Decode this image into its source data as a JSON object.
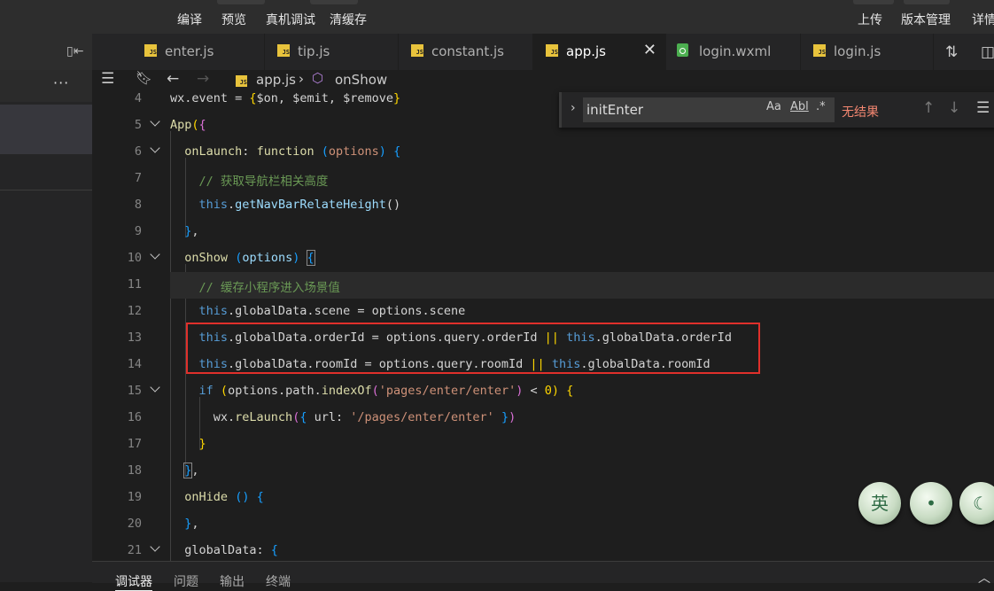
{
  "menu": [
    "编译",
    "预览",
    "真机调试",
    "清缓存",
    "上传",
    "版本管理",
    "详情"
  ],
  "tabs": [
    {
      "label": "enter.js",
      "icon": "js-file-icon"
    },
    {
      "label": "tip.js",
      "icon": "js-file-icon"
    },
    {
      "label": "constant.js",
      "icon": "js-file-icon"
    },
    {
      "label": "app.js",
      "icon": "js-file-icon",
      "active": true
    },
    {
      "label": "login.wxml",
      "icon": "wxml-file-icon"
    },
    {
      "label": "login.js",
      "icon": "js-file-icon"
    }
  ],
  "breadcrumb": {
    "file": "app.js",
    "symbol": "onShow"
  },
  "find": {
    "query": "initEnter",
    "no_results": "无结果",
    "match_case": "Aa",
    "whole_word": "Abl",
    "regex": ".*"
  },
  "editor": {
    "line_numbers": [
      "4",
      "5",
      "6",
      "7",
      "8",
      "9",
      "10",
      "11",
      "12",
      "13",
      "14",
      "15",
      "16",
      "17",
      "18",
      "19",
      "20",
      "21"
    ],
    "comments": [
      "// 获取导航栏相关高度",
      "// 缓存小程序进入场景值"
    ],
    "highlighted_lines": [
      "13",
      "14"
    ]
  },
  "ime": {
    "lang_label": "英"
  },
  "panel_tabs": [
    "调试器",
    "问题",
    "输出",
    "终端"
  ]
}
